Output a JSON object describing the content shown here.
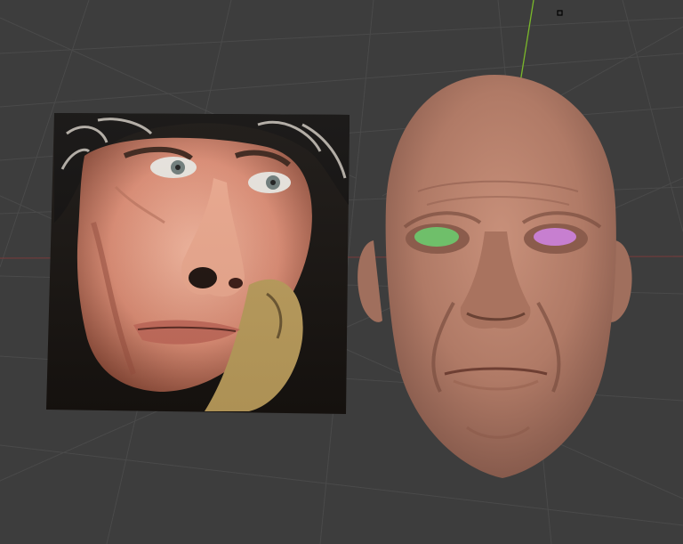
{
  "viewport": {
    "background_color": "#3d3d3d",
    "grid_color": "#4a4a4a",
    "horizon_color": "#7a3a3a",
    "z_axis_color": "#7ab82a"
  },
  "reference_image": {
    "icon": "photo-reference-plane",
    "description_colors": {
      "skin": "#e8a08a",
      "shadow": "#1b1612",
      "collar": "#b89a5a"
    }
  },
  "sculpt_model": {
    "icon": "head-sculpt-mesh",
    "skin_color": "#b57f6c",
    "left_eye_color": "#6fbf6a",
    "right_eye_color": "#c77fd0"
  },
  "object_origin": {
    "icon": "origin-marker-icon"
  }
}
